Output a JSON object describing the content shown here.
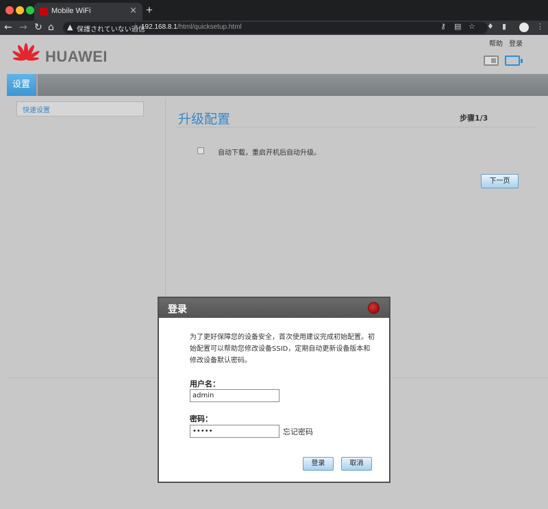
{
  "browser": {
    "tab_title": "Mobile WiFi",
    "tab_close": "×",
    "new_tab": "+",
    "security_text": "保護されていない通信",
    "url_host": "192.168.8.1",
    "url_path": "/html/quicksetup.html"
  },
  "header": {
    "brand": "HUAWEI",
    "help_link": "帮助",
    "login_link": "登录"
  },
  "menu": {
    "settings": "设置"
  },
  "sidebar": {
    "items": [
      {
        "label": "快速设置"
      }
    ]
  },
  "main": {
    "title": "升级配置",
    "step": "步骤1/3",
    "auto_update_label": "自动下载，重启开机后自动升级。",
    "next_button": "下一页"
  },
  "dialog": {
    "title": "登录",
    "message": "为了更好保障您的设备安全，首次使用建议完成初始配置。初始配置可以帮助您修改设备SSID，定期自动更新设备版本和修改设备默认密码。",
    "username_label": "用户名：",
    "username_value": "admin",
    "password_label": "密码：",
    "password_value": "•••••",
    "forgot_password": "忘记密码",
    "login_button": "登录",
    "cancel_button": "取消"
  },
  "colors": {
    "accent_blue": "#3a86c5",
    "menu_bar": "#858a8d",
    "close_red": "#c0181c"
  }
}
